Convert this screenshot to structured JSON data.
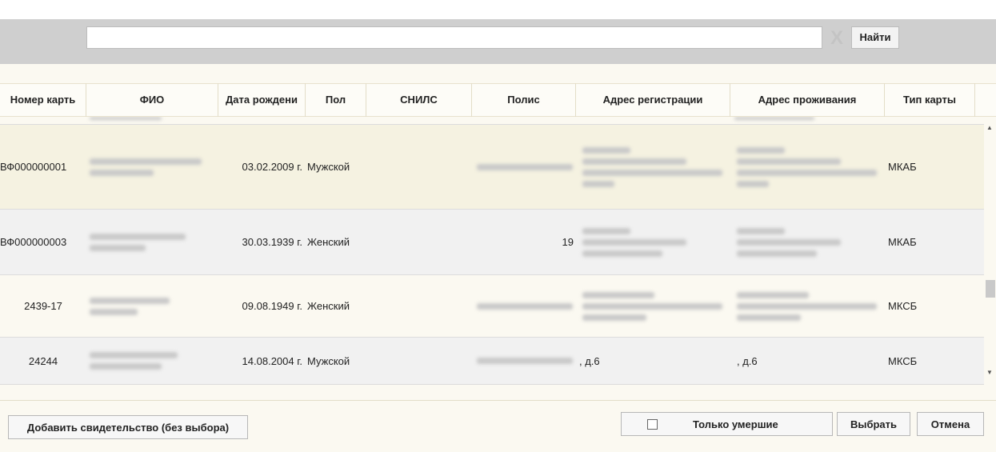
{
  "search": {
    "value": "",
    "placeholder": "",
    "clear_icon": "X",
    "find_label": "Найти"
  },
  "columns": [
    "Номер карть",
    "ФИО",
    "Дата рождени",
    "Пол",
    "СНИЛС",
    "Полис",
    "Адрес регистрации",
    "Адрес проживания",
    "Тип карты"
  ],
  "rows": [
    {
      "card": "ВФ000000001",
      "birth": "03.02.2009 г.",
      "sex": "Мужской",
      "snils": "",
      "polis": "",
      "reg_addr": "",
      "live_addr": "",
      "type": "МКАБ"
    },
    {
      "card": "ВФ000000003",
      "birth": "30.03.1939 г.",
      "sex": "Женский",
      "snils": "",
      "polis": "19",
      "reg_addr": "",
      "live_addr": "",
      "type": "МКАБ"
    },
    {
      "card": "2439-17",
      "birth": "09.08.1949 г.",
      "sex": "Женский",
      "snils": "",
      "polis": "",
      "reg_addr": "",
      "live_addr": "",
      "type": "МКСБ"
    },
    {
      "card": "24244",
      "birth": "14.08.2004 г.",
      "sex": "Мужской",
      "snils": "",
      "polis": "",
      "reg_addr": ", д.6",
      "live_addr": ", д.6",
      "type": "МКСБ"
    }
  ],
  "footer": {
    "add_cert_label": "Добавить свидетельство (без выбора)",
    "only_dead_label": "Только умершие",
    "select_label": "Выбрать",
    "cancel_label": "Отмена"
  }
}
